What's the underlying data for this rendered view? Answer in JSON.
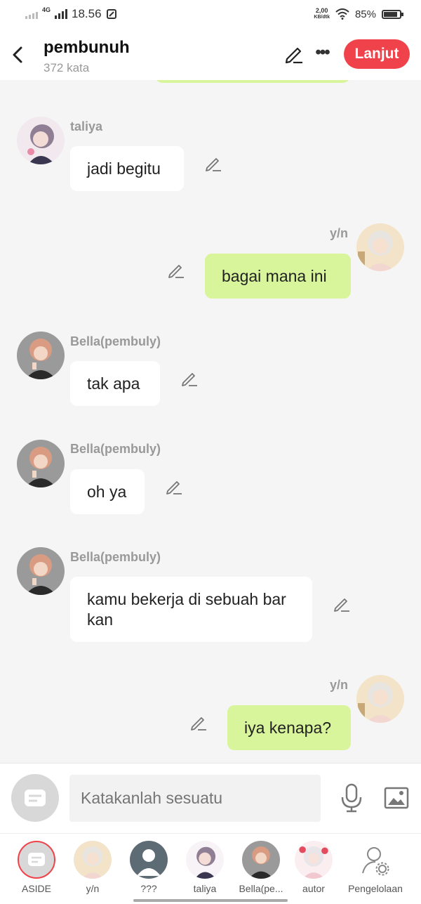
{
  "status": {
    "network": "4G",
    "time": "18.56",
    "speed_top": "2,00",
    "speed_bottom": "KB/dtk",
    "battery": "85%"
  },
  "header": {
    "title": "pembunuh",
    "subtitle": "372 kata",
    "continue_label": "Lanjut"
  },
  "messages": [
    {
      "sender": "taliya",
      "text": "jadi begitu"
    },
    {
      "sender": "y/n",
      "text": "bagai mana ini"
    },
    {
      "sender": "Bella(pembuly)",
      "text": "tak apa"
    },
    {
      "sender": "Bella(pembuly)",
      "text": "oh ya"
    },
    {
      "sender": "Bella(pembuly)",
      "text": "kamu bekerja di sebuah bar kan"
    },
    {
      "sender": "y/n",
      "text": "iya kenapa?"
    }
  ],
  "input": {
    "placeholder": "Katakanlah sesuatu"
  },
  "characters": [
    {
      "label": "ASIDE"
    },
    {
      "label": "y/n"
    },
    {
      "label": "???"
    },
    {
      "label": "taliya"
    },
    {
      "label": "Bella(pe..."
    },
    {
      "label": "autor"
    },
    {
      "label": "Pengelolaan"
    }
  ],
  "colors": {
    "accent": "#f0424a",
    "my_bubble": "#d8f59c",
    "other_bubble": "#ffffff"
  }
}
